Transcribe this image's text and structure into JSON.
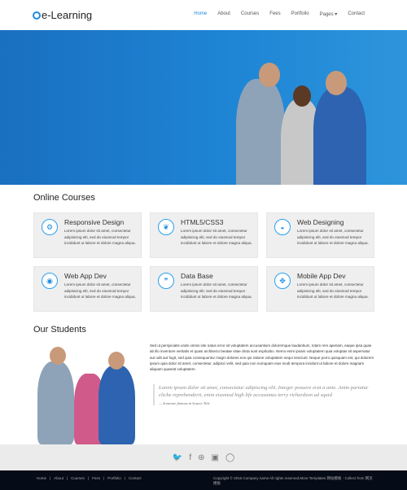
{
  "nav": {
    "logo": "e-Learning",
    "items": [
      {
        "label": "Home",
        "active": true
      },
      {
        "label": "About"
      },
      {
        "label": "Courses"
      },
      {
        "label": "Fees"
      },
      {
        "label": "Portfolio"
      },
      {
        "label": "Pages ▾"
      },
      {
        "label": "Contact"
      }
    ]
  },
  "colors": {
    "accent": "#1c8be0",
    "hero": "#1f7fd0",
    "footer": "#050b17"
  },
  "courses": {
    "title": "Online Courses",
    "items": [
      {
        "icon": "gears-icon",
        "glyph": "⚙",
        "title": "Responsive Design",
        "desc": "Lorem ipsum dolor sit amet, consectetur adipisicing elit, sed do eiusmod tempor incididunt ut labore et dolore magna aliqua."
      },
      {
        "icon": "leaf-icon",
        "glyph": "❦",
        "title": "HTML5/CSS3",
        "desc": "Lorem ipsum dolor sit amet, consectetur adipisicing elit, sed do eiusmod tempor incididunt ut labore et dolore magna aliqua."
      },
      {
        "icon": "dashboard-icon",
        "glyph": "◒",
        "title": "Web Designing",
        "desc": "Lorem ipsum dolor sit amet, consectetur adipisicing elit, sed do eiusmod tempor incididunt ut labore et dolore magna aliqua."
      },
      {
        "icon": "eye-icon",
        "glyph": "◉",
        "title": "Web App Dev",
        "desc": "Lorem ipsum dolor sit amet, consectetur adipisicing elit, sed do eiusmod tempor incididunt ut labore et dolore magna aliqua."
      },
      {
        "icon": "quote-icon",
        "glyph": "❞",
        "title": "Data Base",
        "desc": "Lorem ipsum dolor sit amet, consectetur adipisicing elit, sed do eiusmod tempor incididunt ut labore et dolore magna aliqua."
      },
      {
        "icon": "move-arrows-icon",
        "glyph": "✥",
        "title": "Mobile App Dev",
        "desc": "Lorem ipsum dolor sit amet, consectetur adipisicing elit, sed do eiusmod tempor incididunt ut labore et dolore magna aliqua."
      }
    ]
  },
  "students": {
    "title": "Our Students",
    "paragraph": "Sed ut perspiciatis unde omnis iste natus error sit voluptatem accusantium doloremque laudantium, totam rem aperiam, eaque ipsa quae ab illo inventore veritatis et quasi architecto beatae vitae dicta sunt explicabo. Nemo enim ipsam voluptatem quia voluptas sit aspernatur aut odit aut fugit, sed quia consequuntur magni dolores eos qui ratione voluptatem sequi nesciunt. Neque porro quisquam est, qui dolorem ipsum quia dolor sit amet, consectetur, adipisci velit, sed quia non numquam eius modi tempora incidunt ut labore et dolore magnam aliquam quaerat voluptatem.",
    "quote": "Lorem ipsum dolor sit amet, consectetur adipiscing elit. Integer posuere erat a ante. Anim pariatur cliche reprehenderit, enim eiusmod high life accusamus terry richardson ad squid",
    "source": "— Someone famous in Source Title"
  },
  "social": [
    {
      "icon": "twitter-icon",
      "glyph": "🐦"
    },
    {
      "icon": "facebook-icon",
      "glyph": "f"
    },
    {
      "icon": "dribbble-icon",
      "glyph": "⊛"
    },
    {
      "icon": "flickr-icon",
      "glyph": "▣"
    },
    {
      "icon": "github-icon",
      "glyph": "◯"
    }
  ],
  "footer": {
    "links": [
      "Home",
      "|",
      "About",
      "|",
      "Courses",
      "|",
      "Fees",
      "|",
      "Portfolio",
      "|",
      "Contact"
    ],
    "copyright": "Copyright © 2016 Company name All rights reserved.More Templates 网站模板 - Collect from 网页模板"
  }
}
